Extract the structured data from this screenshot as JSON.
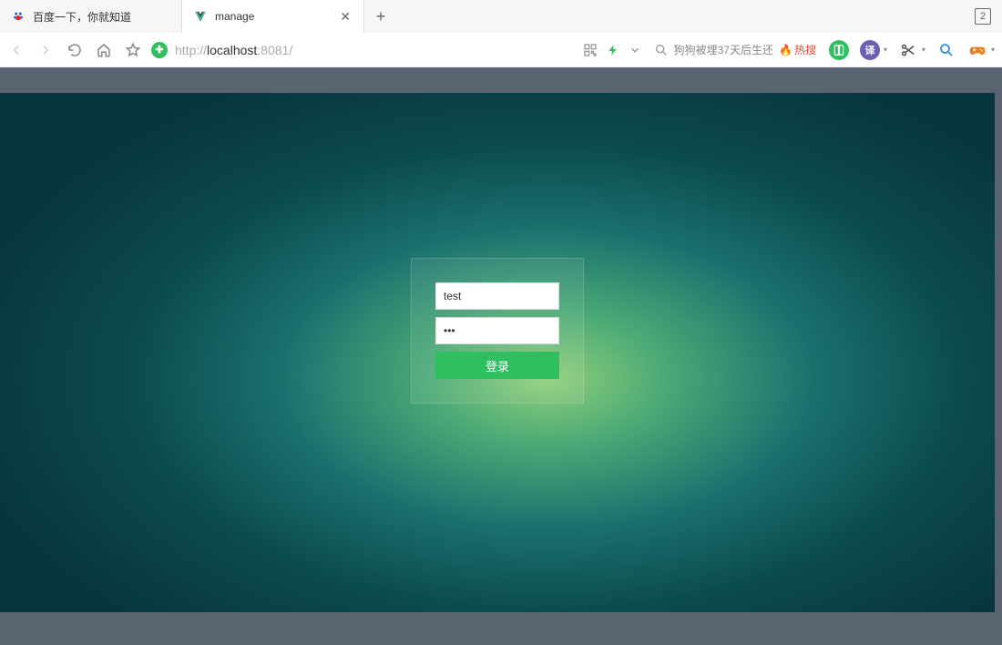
{
  "browser": {
    "tabs": [
      {
        "title": "百度一下，你就知道",
        "active": false,
        "icon": "baidu"
      },
      {
        "title": "manage",
        "active": true,
        "icon": "vue"
      }
    ],
    "tab_count": "2",
    "url": {
      "scheme": "http://",
      "host": "localhost",
      "port": ":8081",
      "path": "/"
    },
    "search": {
      "text": "狗狗被埋37天后生还",
      "hot_label": "热搜"
    },
    "extensions": {
      "translate_label": "译"
    }
  },
  "login": {
    "username_value": "test",
    "password_value": "•••",
    "submit_label": "登录"
  },
  "colors": {
    "accent_green": "#2fbe60",
    "hot_red": "#e74c3c"
  }
}
